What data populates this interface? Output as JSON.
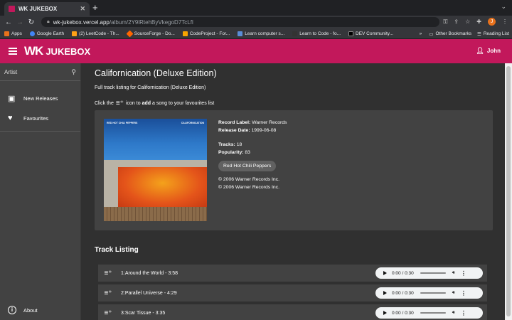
{
  "browser": {
    "tab_title": "WK JUKEBOX",
    "tab_close": "✕",
    "new_tab": "+",
    "url_host": "wk-jukebox.vercel.app",
    "url_path": "/album/2Y9lRtehByVkegoD7TcLfl",
    "bookmarks": [
      {
        "label": "Apps",
        "color": "#e8711c"
      },
      {
        "label": "Google Earth",
        "color": "#4285f4"
      },
      {
        "label": "(2) LeetCode - Th...",
        "color": "#ffa116"
      },
      {
        "label": "SourceForge - Do...",
        "color": "#ff6600"
      },
      {
        "label": "CodeProject - For...",
        "color": "#f7a400"
      },
      {
        "label": "Learn computer s...",
        "color": "#5b8dd6"
      },
      {
        "label": "Learn to Code - fo...",
        "color": "#333333"
      },
      {
        "label": "DEV Community...",
        "color": "#000000"
      }
    ],
    "bookmarks_more": "»",
    "other_bookmarks": "Other Bookmarks",
    "reading_list": "Reading List",
    "profile_initial": "J"
  },
  "appbar": {
    "logo": "WK",
    "brand": "JUKEBOX",
    "user_name": "John"
  },
  "sidebar": {
    "search_label": "Artist",
    "items": [
      {
        "label": "New Releases",
        "icon": "library-music-icon"
      },
      {
        "label": "Favourites",
        "icon": "heart-icon"
      }
    ],
    "about": "About"
  },
  "album": {
    "title": "Californication (Deluxe Edition)",
    "subtitle": "Full track listing for Californication (Deluxe Edition)",
    "hint_pre": "Click the",
    "hint_mid": "icon to",
    "hint_bold": "add",
    "hint_post": "a song to your favourites list",
    "cover_band": "RED HOT CHILI PEPPERS",
    "cover_title": "CALIFORNICATION",
    "record_label_key": "Record Label:",
    "record_label": "Warner Records",
    "release_date_key": "Release Date:",
    "release_date": "1999-06-08",
    "tracks_key": "Tracks:",
    "tracks": "18",
    "popularity_key": "Popularity:",
    "popularity": "83",
    "artist_chip": "Red Hot Chili Peppers",
    "copyright_1": "© 2006 Warner Records Inc.",
    "copyright_2": "© 2006 Warner Records Inc."
  },
  "track_listing": {
    "heading": "Track Listing",
    "tracks": [
      {
        "label": "1:Around the World - 3:58",
        "time": "0:00 / 0:30"
      },
      {
        "label": "2:Parallel Universe - 4:29",
        "time": "0:00 / 0:30"
      },
      {
        "label": "3:Scar Tissue - 3:35",
        "time": "0:00 / 0:30"
      }
    ]
  },
  "colors": {
    "accent": "#c2185b",
    "background": "#303030",
    "panel": "#424242"
  }
}
